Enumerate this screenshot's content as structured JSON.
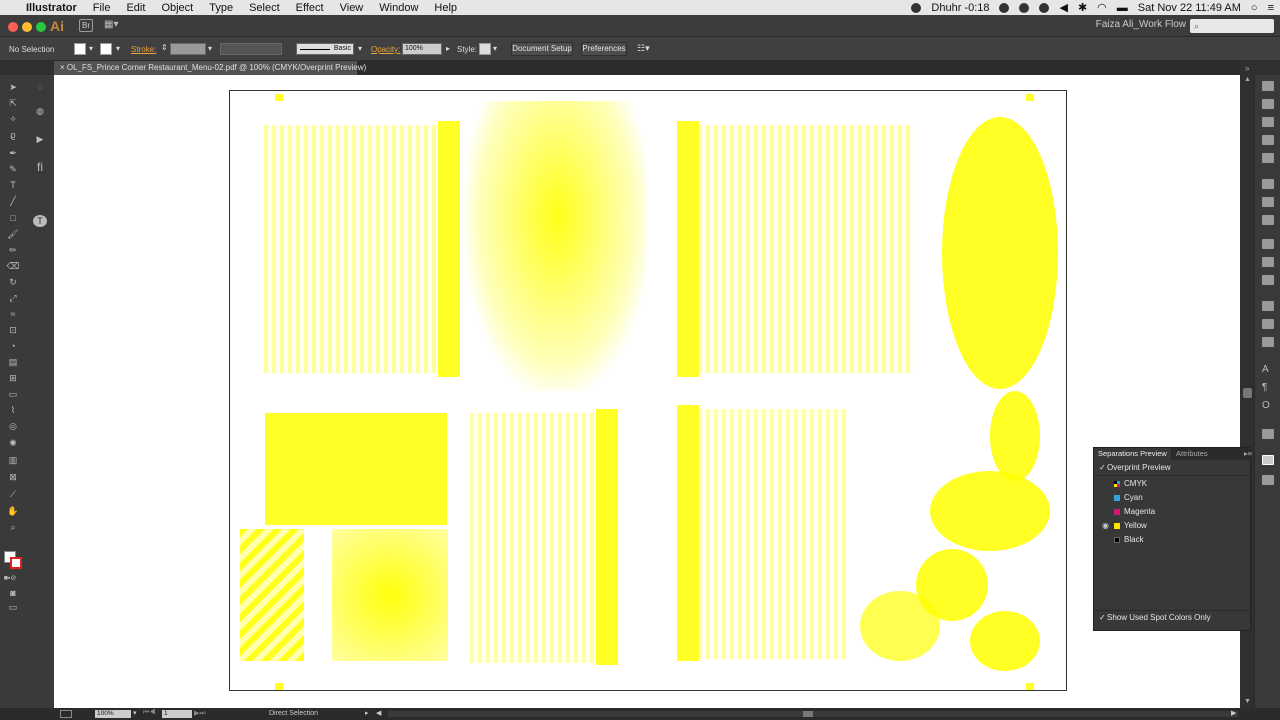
{
  "menubar": {
    "app_name": "Illustrator",
    "items": [
      "File",
      "Edit",
      "Object",
      "Type",
      "Select",
      "Effect",
      "View",
      "Window",
      "Help"
    ],
    "prayer": "Dhuhr -0:18",
    "datetime": "Sat Nov 22  11:49 AM"
  },
  "appbar": {
    "logo": "Ai",
    "bridge": "Br",
    "workspace": "Faiza Ali_Work Flow"
  },
  "control": {
    "selection": "No Selection",
    "stroke_label": "Stroke:",
    "brush": "Basic",
    "opacity_label": "Opacity:",
    "opacity_value": "100%",
    "style_label": "Style:",
    "doc_setup": "Document Setup",
    "preferences": "Preferences"
  },
  "document": {
    "tab_close": "×",
    "tab_title": "OL_FS_Prince Corner Restaurant_Menu-02.pdf @ 100% (CMYK/Overprint Preview)"
  },
  "separations": {
    "tab_active": "Separations Preview",
    "tab_other": "Attributes",
    "check": "✓",
    "overprint": "Overprint Preview",
    "inks": [
      {
        "name": "CMYK",
        "color": "#ffffff"
      },
      {
        "name": "Cyan",
        "color": "#2ea3dd"
      },
      {
        "name": "Magenta",
        "color": "#d0197e"
      },
      {
        "name": "Yellow",
        "color": "#ffe600"
      },
      {
        "name": "Black",
        "color": "#000000"
      }
    ],
    "spot_only": "Show Used Spot Colors Only"
  },
  "status": {
    "zoom": "100%",
    "page": "1",
    "tool": "Direct Selection"
  }
}
